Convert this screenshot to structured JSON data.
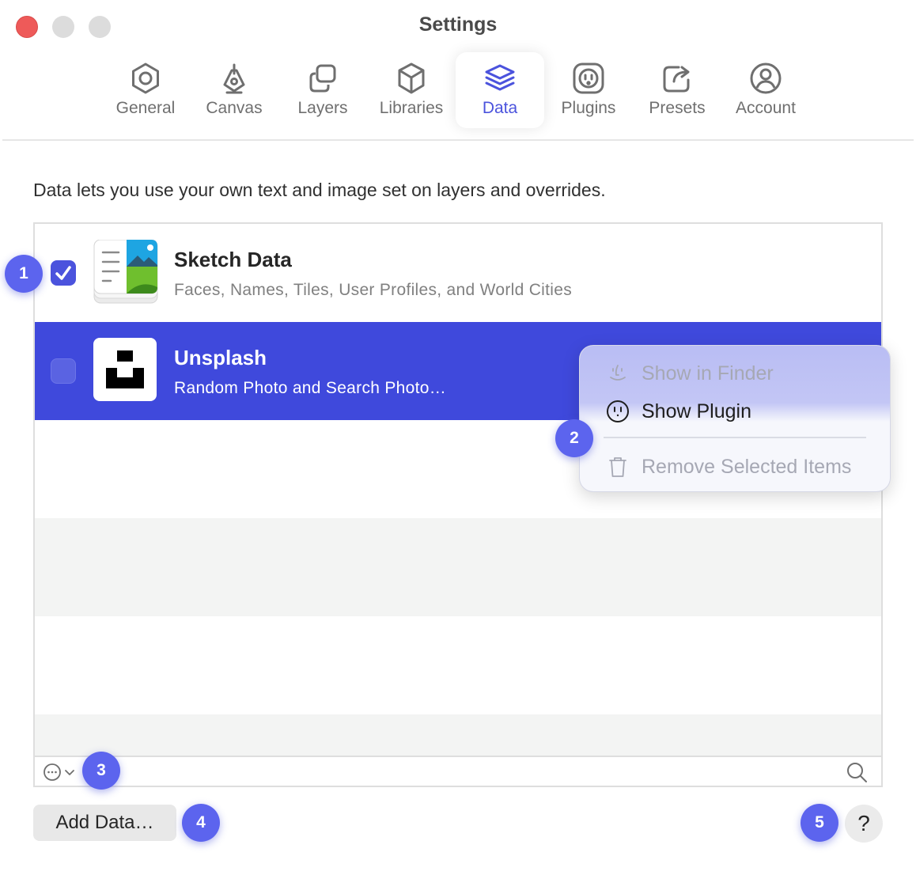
{
  "window": {
    "title": "Settings"
  },
  "tabs": [
    {
      "label": "General",
      "icon": "hexagon-gear-icon",
      "active": false
    },
    {
      "label": "Canvas",
      "icon": "pen-nib-icon",
      "active": false
    },
    {
      "label": "Layers",
      "icon": "layers-squares-icon",
      "active": false
    },
    {
      "label": "Libraries",
      "icon": "cube-icon",
      "active": false
    },
    {
      "label": "Data",
      "icon": "stack-icon",
      "active": true
    },
    {
      "label": "Plugins",
      "icon": "plug-socket-icon",
      "active": false
    },
    {
      "label": "Presets",
      "icon": "share-box-icon",
      "active": false
    },
    {
      "label": "Account",
      "icon": "user-circle-icon",
      "active": false
    }
  ],
  "description": "Data lets you use your own text and image set on layers and overrides.",
  "data_list": {
    "items": [
      {
        "title": "Sketch Data",
        "subtitle": "Faces, Names, Tiles, User Profiles, and World Cities",
        "checked": true,
        "selected": false
      },
      {
        "title": "Unsplash",
        "subtitle": "Random Photo and Search Photo…",
        "checked": false,
        "selected": true
      }
    ]
  },
  "context_menu": {
    "items": [
      {
        "label": "Show in Finder",
        "icon": "finder-icon",
        "enabled": false
      },
      {
        "label": "Show Plugin",
        "icon": "plug-icon",
        "enabled": true
      },
      {
        "label": "Remove Selected Items",
        "icon": "trash-icon",
        "enabled": false
      }
    ]
  },
  "footer": {
    "add_label": "Add Data…",
    "help_label": "?"
  },
  "badges": [
    "1",
    "2",
    "3",
    "4",
    "5"
  ],
  "colors": {
    "accent": "#4b53dd",
    "selected_row": "#3f49dc",
    "badge": "#5c64ee",
    "close": "#ee5a59"
  }
}
